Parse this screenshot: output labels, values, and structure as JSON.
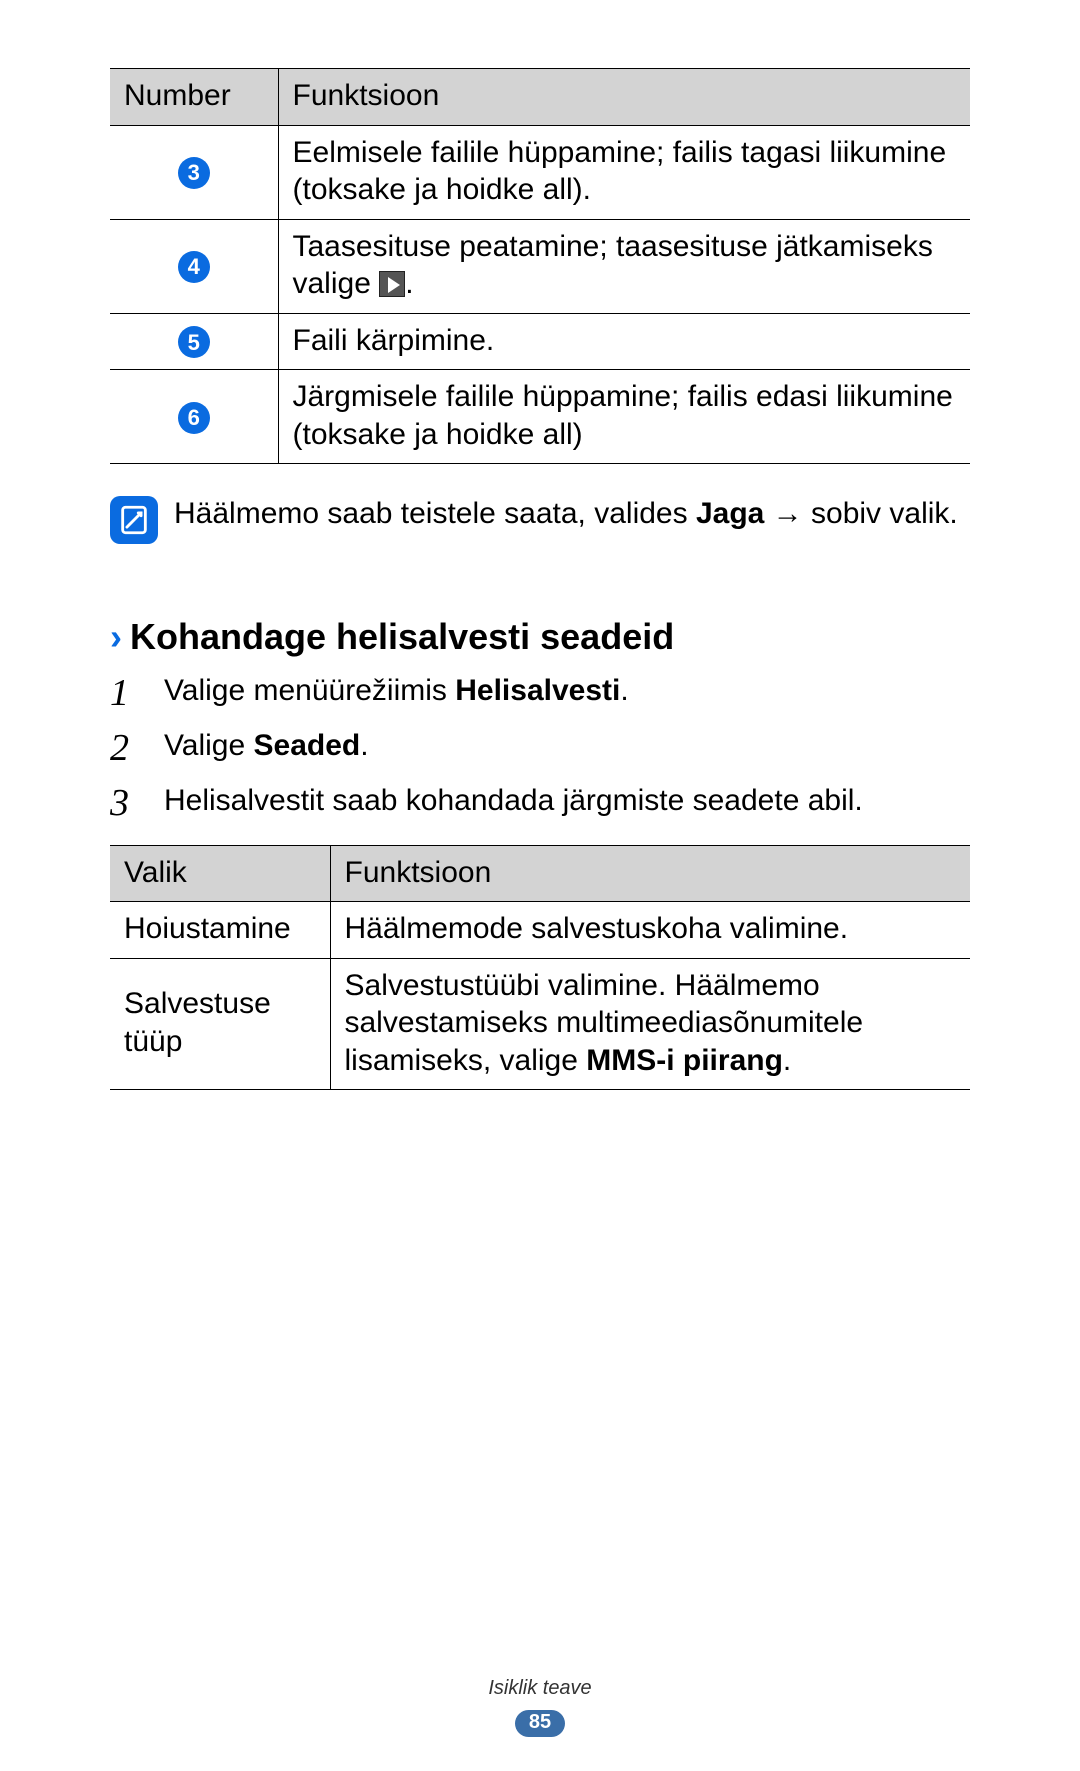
{
  "table1": {
    "header_l": "Number",
    "header_r": "Funktsioon",
    "rows": [
      {
        "n": "3",
        "desc": "Eelmisele failile hüppamine; failis tagasi liikumine (toksake ja hoidke all)."
      },
      {
        "n": "4",
        "desc_a": "Taasesituse peatamine; taasesituse jätkamiseks valige ",
        "desc_b": "."
      },
      {
        "n": "5",
        "desc": "Faili kärpimine."
      },
      {
        "n": "6",
        "desc": "Järgmisele failile hüppamine; failis edasi liikumine (toksake ja hoidke all)"
      }
    ]
  },
  "note": {
    "text_a": "Häälmemo saab teistele saata, valides ",
    "bold": "Jaga",
    "arrow": " → ",
    "text_b": "sobiv valik."
  },
  "section": {
    "heading": "Kohandage helisalvesti seadeid"
  },
  "steps": [
    {
      "n": "1",
      "t_a": "Valige menüürežiimis ",
      "b": "Helisalvesti",
      "t_b": "."
    },
    {
      "n": "2",
      "t_a": "Valige ",
      "b": "Seaded",
      "t_b": "."
    },
    {
      "n": "3",
      "t_a": "Helisalvestit saab kohandada järgmiste seadete abil.",
      "b": "",
      "t_b": ""
    }
  ],
  "table2": {
    "header_l": "Valik",
    "header_r": "Funktsioon",
    "rows": [
      {
        "l": "Hoiustamine",
        "r_a": "Häälmemode salvestuskoha valimine.",
        "r_bold": "",
        "r_b": ""
      },
      {
        "l": "Salvestuse tüüp",
        "r_a": "Salvestustüübi valimine. Häälmemo salvestamiseks multimeediasõnumitele lisamiseks, valige ",
        "r_bold": "MMS-i piirang",
        "r_b": "."
      }
    ]
  },
  "footer": {
    "section": "Isiklik teave",
    "page": "85"
  }
}
